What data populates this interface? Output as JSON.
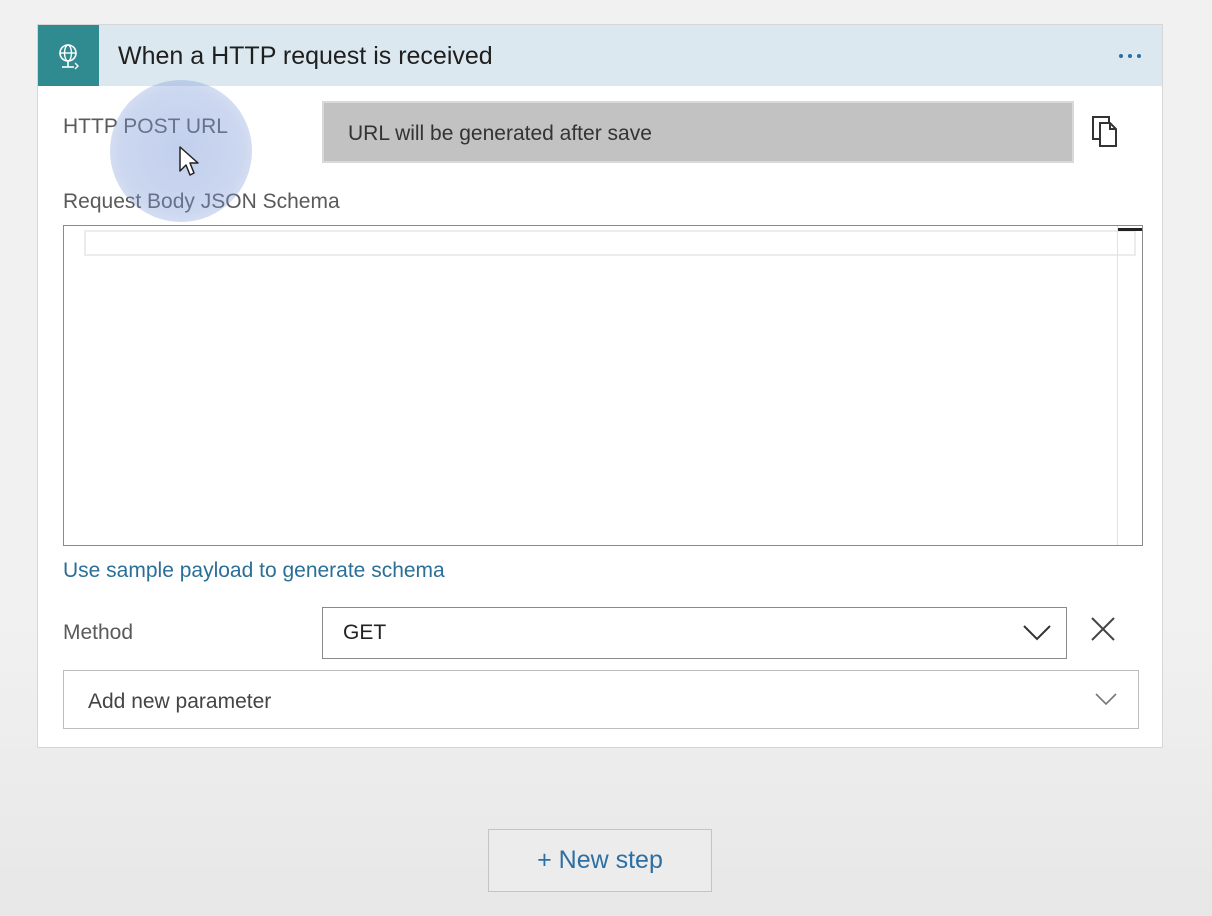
{
  "trigger_card": {
    "title": "When a HTTP request is received",
    "icon": "globe-request-icon",
    "more_icon": "ellipsis-icon",
    "colors": {
      "header_bg": "#dbe8ef",
      "icon_bg": "#2f8b8f",
      "accent": "#2d6fa3"
    }
  },
  "url_field": {
    "label": "HTTP POST URL",
    "value": "URL will be generated after save",
    "copy_icon": "copy-icon"
  },
  "schema_field": {
    "label": "Request Body JSON Schema",
    "value": ""
  },
  "sample_link": "Use sample payload to generate schema",
  "method_field": {
    "label": "Method",
    "value": "GET",
    "dropdown_icon": "chevron-down-icon",
    "remove_icon": "close-icon"
  },
  "add_parameter": {
    "label": "Add new parameter",
    "dropdown_icon": "chevron-down-icon"
  },
  "new_step_button": "+ New step"
}
